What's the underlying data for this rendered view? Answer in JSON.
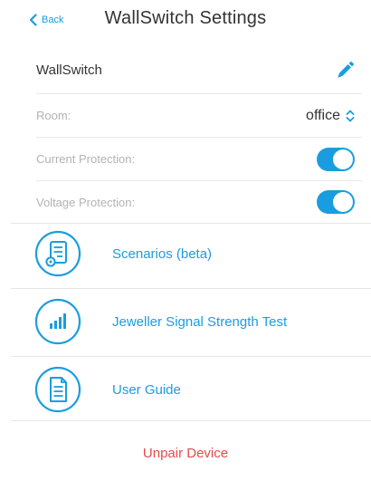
{
  "nav": {
    "back_label": "Back",
    "title": "WallSwitch Settings"
  },
  "device": {
    "name": "WallSwitch"
  },
  "room": {
    "label": "Room:",
    "value": "office"
  },
  "current_protection": {
    "label": "Current Protection:",
    "enabled": true
  },
  "voltage_protection": {
    "label": "Voltage Protection:",
    "enabled": true
  },
  "menu": [
    {
      "label": "Scenarios (beta)",
      "icon": "scenarios-icon"
    },
    {
      "label": "Jeweller Signal Strength Test",
      "icon": "signal-strength-icon"
    },
    {
      "label": "User Guide",
      "icon": "user-guide-icon"
    }
  ],
  "unpair_label": "Unpair Device",
  "colors": {
    "accent": "#1a9de0",
    "danger": "#e34b4b",
    "muted": "#b3b3b3"
  }
}
